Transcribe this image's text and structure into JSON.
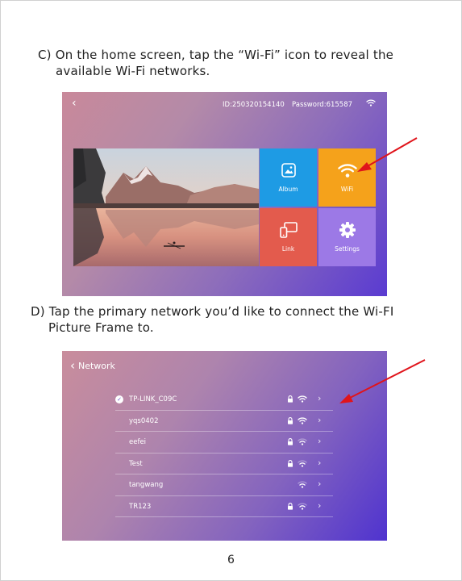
{
  "steps": {
    "c_line1": "C) On the home screen, tap the “Wi-Fi” icon to reveal the",
    "c_line2": "available Wi-Fi networks.",
    "d_line1": "D) Tap the primary network you’d like to connect the Wi-FI",
    "d_line2": "Picture Frame to."
  },
  "home_screen": {
    "back_glyph": "‹",
    "device_id": "ID:250320154140",
    "password": "Password:615587",
    "tiles": {
      "album": "Album",
      "wifi": "WiFi",
      "link": "Link",
      "settings": "Settings"
    },
    "colors": {
      "album": "#1e9be4",
      "wifi": "#f5a21b",
      "link": "#e35b4d",
      "settings": "#9c79e6"
    }
  },
  "network_screen": {
    "title": "Network",
    "networks": [
      {
        "ssid": "TP-LINK_C09C",
        "connected": true,
        "secured": true,
        "signal": "strong"
      },
      {
        "ssid": "yqs0402",
        "connected": false,
        "secured": true,
        "signal": "strong"
      },
      {
        "ssid": "eefei",
        "connected": false,
        "secured": true,
        "signal": "medium"
      },
      {
        "ssid": "Test",
        "connected": false,
        "secured": true,
        "signal": "medium"
      },
      {
        "ssid": "tangwang",
        "connected": false,
        "secured": false,
        "signal": "medium"
      },
      {
        "ssid": "TR123",
        "connected": false,
        "secured": true,
        "signal": "medium"
      }
    ]
  },
  "annotation_color": "#e0141b",
  "page_number": "6"
}
